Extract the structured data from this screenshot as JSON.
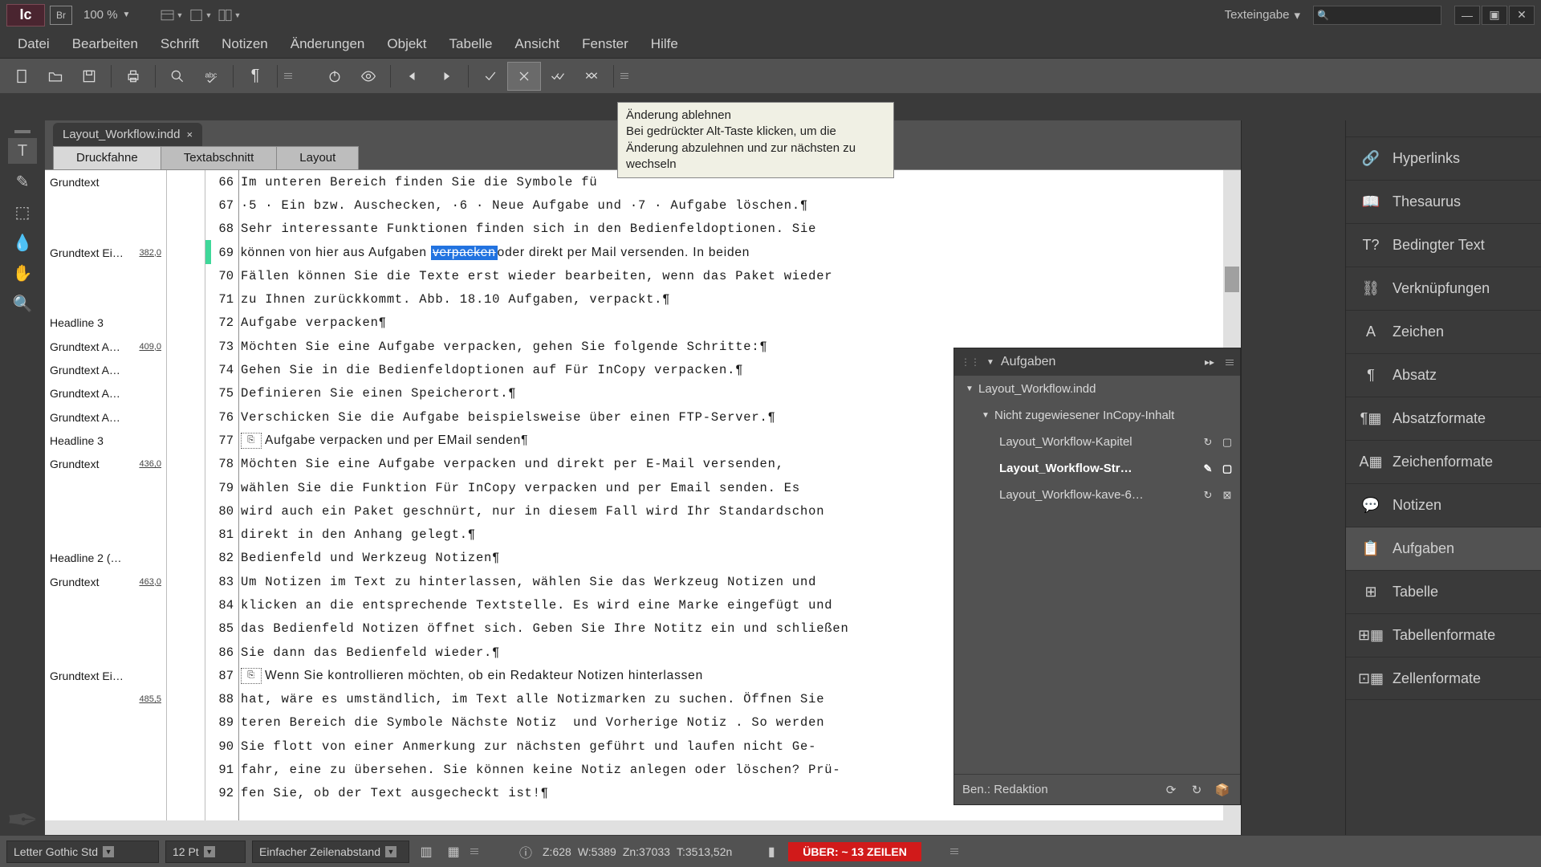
{
  "app": {
    "badge": "Ic",
    "br": "Br",
    "zoom": "100 %"
  },
  "workspace": {
    "label": "Texteingabe"
  },
  "menu": [
    "Datei",
    "Bearbeiten",
    "Schrift",
    "Notizen",
    "Änderungen",
    "Objekt",
    "Tabelle",
    "Ansicht",
    "Fenster",
    "Hilfe"
  ],
  "tooltip": {
    "title": "Änderung ablehnen",
    "body": "Bei gedrückter Alt-Taste klicken, um die Änderung abzulehnen und zur nächsten zu wechseln"
  },
  "doc": {
    "tab": "Layout_Workflow.indd"
  },
  "view_tabs": [
    "Druckfahne",
    "Textabschnitt",
    "Layout"
  ],
  "styles": [
    {
      "n": "Grundtext"
    },
    {
      "n": ""
    },
    {
      "n": ""
    },
    {
      "n": "Grundtext Ei…",
      "m": "382,0"
    },
    {
      "n": ""
    },
    {
      "n": ""
    },
    {
      "n": "Headline 3"
    },
    {
      "n": "Grundtext A…",
      "m": "409,0"
    },
    {
      "n": "Grundtext A…"
    },
    {
      "n": "Grundtext A…"
    },
    {
      "n": "Grundtext A…"
    },
    {
      "n": "Headline 3"
    },
    {
      "n": "Grundtext",
      "m": "436,0"
    },
    {
      "n": ""
    },
    {
      "n": ""
    },
    {
      "n": ""
    },
    {
      "n": "Headline 2 (…"
    },
    {
      "n": "Grundtext",
      "m": "463,0"
    },
    {
      "n": ""
    },
    {
      "n": ""
    },
    {
      "n": ""
    },
    {
      "n": "Grundtext Ei…"
    },
    {
      "n": "",
      "m": "485,5"
    },
    {
      "n": ""
    },
    {
      "n": ""
    },
    {
      "n": ""
    },
    {
      "n": ""
    }
  ],
  "first_line": 66,
  "lines": [
    "Im unteren Bereich finden Sie die Symbole fü",
    "·5 · Ein bzw. Auschecken, ·6 · Neue Aufgabe und ·7 · Aufgabe löschen.¶",
    "Sehr interessante Funktionen finden sich in den Bedienfeldoptionen. Sie",
    "können von hier aus Aufgaben ",
    "Fällen können Sie die Texte erst wieder bearbeiten, wenn das Paket wieder",
    "zu Ihnen zurückkommt. Abb. 18.10 Aufgaben, verpackt.¶",
    "Aufgabe verpacken¶",
    "Möchten Sie eine Aufgabe verpacken, gehen Sie folgende Schritte:¶",
    "Gehen Sie in die Bedienfeldoptionen auf Für InCopy verpacken.¶",
    "Definieren Sie einen Speicherort.¶",
    "Verschicken Sie die Aufgabe beispielsweise über einen FTP-Server.¶",
    "Aufgabe verpacken und per EMail senden¶",
    "Möchten Sie eine Aufgabe verpacken und direkt per E-Mail versenden,",
    "wählen Sie die Funktion Für InCopy verpacken und per Email senden. Es",
    "wird auch ein Paket geschnürt, nur in diesem Fall wird Ihr Standardschon",
    "direkt in den Anhang gelegt.¶",
    "Bedienfeld und Werkzeug Notizen¶",
    "Um Notizen im Text zu hinterlassen, wählen Sie das Werkzeug Notizen und",
    "klicken an die entsprechende Textstelle. Es wird eine Marke eingefügt und",
    "das Bedienfeld Notizen öffnet sich. Geben Sie Ihre Notitz ein und schließen",
    "Sie dann das Bedienfeld wieder.¶",
    "Wenn Sie kontrollieren möchten, ob ein Redakteur Notizen hinterlassen",
    "hat, wäre es umständlich, im Text alle Notizmarken zu suchen. Öffnen Sie",
    "teren Bereich die Symbole Nächste Notiz  und Vorherige Notiz . So werden",
    "Sie flott von einer Anmerkung zur nächsten geführt und laufen nicht Ge-",
    "fahr, eine zu übersehen. Sie können keine Notiz anlegen oder löschen? Prü-",
    "fen Sie, ob der Text ausgecheckt ist!¶"
  ],
  "track": {
    "text": "verpacken",
    "after": "oder direkt per Mail versenden. In beiden"
  },
  "aufgaben": {
    "title": "Aufgaben",
    "root": "Layout_Workflow.indd",
    "group": "Nicht zugewiesener InCopy-Inhalt",
    "items": [
      {
        "n": "Layout_Workflow-Kapitel",
        "sel": false,
        "a": "↻",
        "b": "▢"
      },
      {
        "n": "Layout_Workflow-Str…",
        "sel": true,
        "a": "✎",
        "b": "▢"
      },
      {
        "n": "Layout_Workflow-kave-6…",
        "sel": false,
        "a": "↻",
        "b": "⊠"
      }
    ],
    "user": "Ben.: Redaktion"
  },
  "dock": [
    {
      "n": "Hyperlinks",
      "i": "🔗"
    },
    {
      "n": "Thesaurus",
      "i": "📖"
    },
    {
      "n": "Bedingter Text",
      "i": "T?"
    },
    {
      "n": "Verknüpfungen",
      "i": "⛓"
    },
    {
      "n": "Zeichen",
      "i": "A"
    },
    {
      "n": "Absatz",
      "i": "¶"
    },
    {
      "n": "Absatzformate",
      "i": "¶▦"
    },
    {
      "n": "Zeichenformate",
      "i": "A▦"
    },
    {
      "n": "Notizen",
      "i": "💬"
    },
    {
      "n": "Aufgaben",
      "i": "📋",
      "active": true
    },
    {
      "n": "Tabelle",
      "i": "⊞"
    },
    {
      "n": "Tabellenformate",
      "i": "⊞▦"
    },
    {
      "n": "Zellenformate",
      "i": "⊡▦"
    }
  ],
  "status": {
    "font": "Letter Gothic Std",
    "size": "12 Pt",
    "leading": "Einfacher Zeilenabstand",
    "Z": "Z:628",
    "W": "W:5389",
    "Zn": "Zn:37033",
    "T": "T:3513,52n",
    "over": "ÜBER:  ~ 13 ZEILEN"
  }
}
